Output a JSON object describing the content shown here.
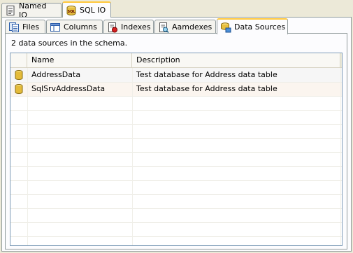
{
  "outer_tabs": [
    {
      "label": "Named IO",
      "icon": "document-icon",
      "active": false
    },
    {
      "label": "SQL IO",
      "icon": "sql-icon",
      "active": true
    }
  ],
  "inner_tabs": [
    {
      "label": "Files",
      "icon": "files-icon",
      "active": false
    },
    {
      "label": "Columns",
      "icon": "columns-icon",
      "active": false
    },
    {
      "label": "Indexes",
      "icon": "indexes-icon",
      "active": false
    },
    {
      "label": "Aamdexes",
      "icon": "aamdexes-icon",
      "active": false
    },
    {
      "label": "Data Sources",
      "icon": "data-sources-icon",
      "active": true
    }
  ],
  "status": "2 data sources in the schema.",
  "grid": {
    "columns": [
      "Name",
      "Description"
    ],
    "rows": [
      {
        "name": "AddressData",
        "description": "Test database for Address data table",
        "icon": "database-icon"
      },
      {
        "name": "SqlSrvAddressData",
        "description": "Test database for Address data table",
        "icon": "database-icon"
      }
    ]
  },
  "colors": {
    "tab_highlight": "#ffc83c",
    "border": "#919b9c",
    "panel": "#ece9d8"
  }
}
